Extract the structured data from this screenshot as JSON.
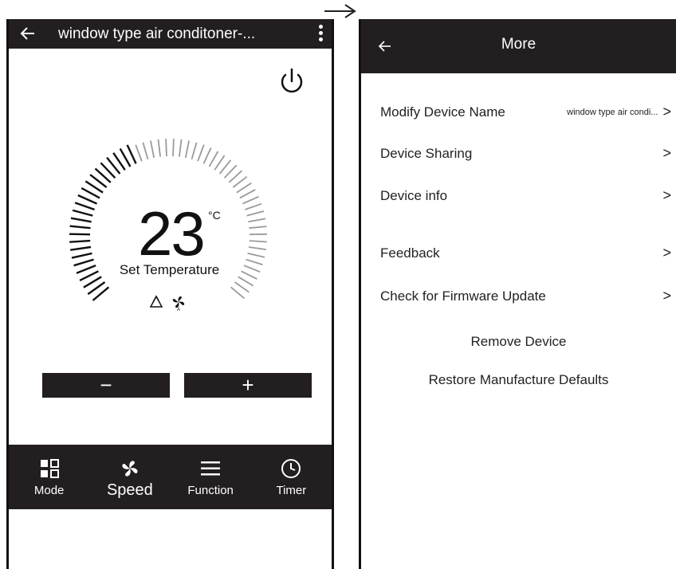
{
  "left_screen": {
    "title": "window type air conditoner-...",
    "temperature": "23",
    "unit": "°C",
    "temp_label": "Set Temperature",
    "minus_label": "−",
    "plus_label": "+",
    "tabs": [
      {
        "label": "Mode",
        "icon": "mode-icon"
      },
      {
        "label": "Speed",
        "icon": "fan-icon"
      },
      {
        "label": "Function",
        "icon": "menu-lines-icon"
      },
      {
        "label": "Timer",
        "icon": "clock-icon"
      }
    ]
  },
  "right_screen": {
    "title": "More",
    "items": [
      {
        "label": "Modify Device Name",
        "value": "window type air condi..."
      },
      {
        "label": "Device Sharing"
      },
      {
        "label": "Device info"
      },
      {
        "label": "Feedback"
      },
      {
        "label": "Check for Firmware Update"
      }
    ],
    "remove_label": "Remove Device",
    "restore_label": "Restore Manufacture Defaults"
  },
  "colors": {
    "bar": "#231f20",
    "text": "#222222",
    "background": "#ffffff"
  }
}
